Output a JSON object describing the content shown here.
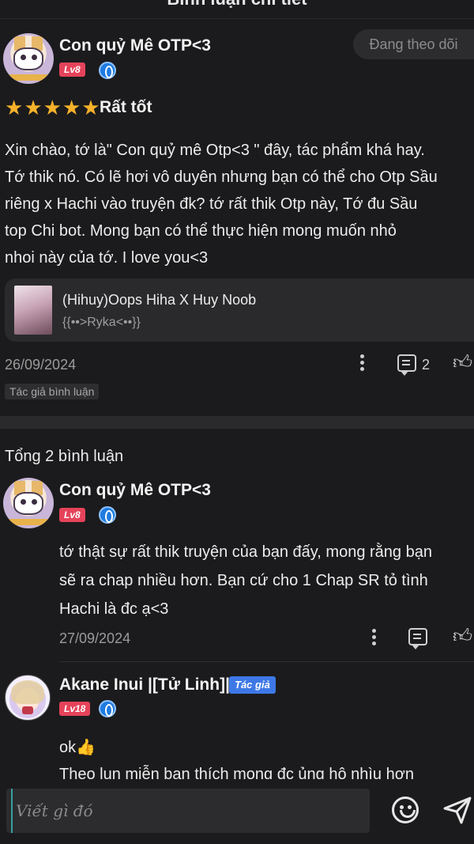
{
  "header": {
    "title": "Bình luận chi tiết"
  },
  "review": {
    "username": "Con quỷ Mê OTP<3",
    "level": "Lv8",
    "follow_label": "Đang theo dõi",
    "stars": 5,
    "rating_label": "Rất tốt",
    "text_lines": [
      "Xin chào, tớ là\" Con quỷ mê Otp<3 \" đây, tác phẩm khá hay.",
      "Tớ thik nó. Có lẽ hơi vô duyên nhưng bạn có thể cho Otp Sầu",
      "riêng x Hachi vào truyện đk? tớ rất thik Otp này, Tớ đu Sầu",
      "top Chi bot. Mong bạn có thể thực hiện mong muốn nhỏ",
      "nhoi này của tớ. I love you<3"
    ],
    "referenced_work": {
      "title": "(Hihuy)Oops Hiha X Huy Noob",
      "author": "{{••>Ryka<••}}"
    },
    "date": "26/09/2024",
    "reply_count": "2",
    "author_chip": "Tác giả bình luận"
  },
  "replies_section": {
    "total_label": "Tổng 2 bình luận",
    "replies": [
      {
        "username": "Con quỷ Mê OTP<3",
        "level": "Lv8",
        "text_lines": [
          "tớ thật sự rất thik truyện của bạn đấy, mong rằng bạn",
          "sẽ ra chap nhiều hơn. Bạn cứ cho 1 Chap SR tỏ tình",
          "Hachi là đc ạ<3"
        ],
        "date": "27/09/2024"
      },
      {
        "username": "Akane Inui |[Tử Linh]|",
        "author_badge": "Tác giả",
        "level": "Lv18",
        "text_lines": [
          "ok👍",
          "Theo lun miễn bạn thích mong đc ủng hộ nhìu hơn"
        ]
      }
    ]
  },
  "composer": {
    "placeholder": "Viết gì đó"
  }
}
